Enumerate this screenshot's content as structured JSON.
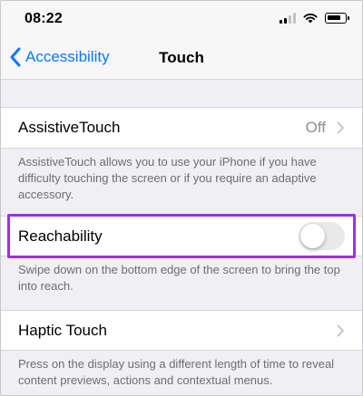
{
  "status_bar": {
    "time": "08:22"
  },
  "nav": {
    "back_label": "Accessibility",
    "title": "Touch"
  },
  "cells": {
    "assistive_touch": {
      "label": "AssistiveTouch",
      "value": "Off"
    },
    "reachability": {
      "label": "Reachability",
      "toggle_on": false
    },
    "haptic_touch": {
      "label": "Haptic Touch"
    }
  },
  "notes": {
    "assistive_touch": "AssistiveTouch allows you to use your iPhone if you have difficulty touching the screen or if you require an adaptive accessory.",
    "reachability": "Swipe down on the bottom edge of the screen to bring the top into reach.",
    "haptic_touch": "Press on the display using a different length of time to reveal content previews, actions and contextual menus."
  },
  "colors": {
    "accent": "#0a7aff",
    "highlight": "#9b30e8",
    "background": "#efeff4"
  },
  "icons": [
    "cellular-signal-icon",
    "wifi-icon",
    "battery-icon",
    "back-chevron-icon",
    "chevron-right-icon"
  ]
}
